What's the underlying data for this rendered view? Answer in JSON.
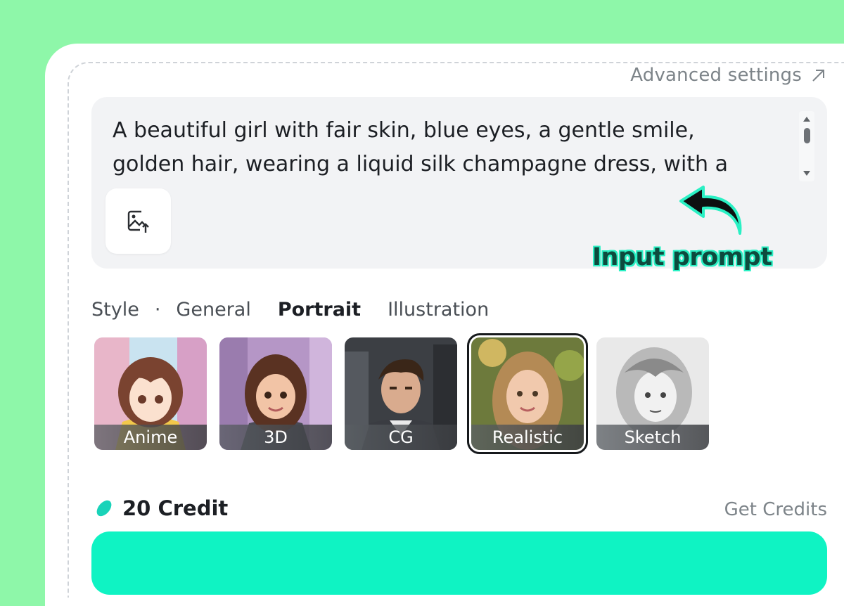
{
  "header": {
    "advanced_settings": "Advanced settings"
  },
  "prompt": {
    "text": "A beautiful girl with fair skin, blue eyes, a gentle smile,\ngolden hair, wearing a liquid silk champagne dress, with a"
  },
  "annotation": {
    "label": "Input prompt"
  },
  "style": {
    "label": "Style",
    "separator": "·",
    "tabs": [
      {
        "label": "General",
        "active": false
      },
      {
        "label": "Portrait",
        "active": true
      },
      {
        "label": "Illustration",
        "active": false
      }
    ],
    "presets": [
      {
        "label": "Anime",
        "selected": false
      },
      {
        "label": "3D",
        "selected": false
      },
      {
        "label": "CG",
        "selected": false
      },
      {
        "label": "Realistic",
        "selected": true
      },
      {
        "label": "Sketch",
        "selected": false
      }
    ]
  },
  "credits": {
    "balance": "20 Credit",
    "get_credits": "Get Credits"
  },
  "colors": {
    "background": "#8ef7a9",
    "accent": "#0ff3c3",
    "annotation": "#2af0c4"
  },
  "icons": [
    "arrow-up-right-icon",
    "image-upload-icon",
    "curved-arrow-icon",
    "credit-bean-icon"
  ]
}
